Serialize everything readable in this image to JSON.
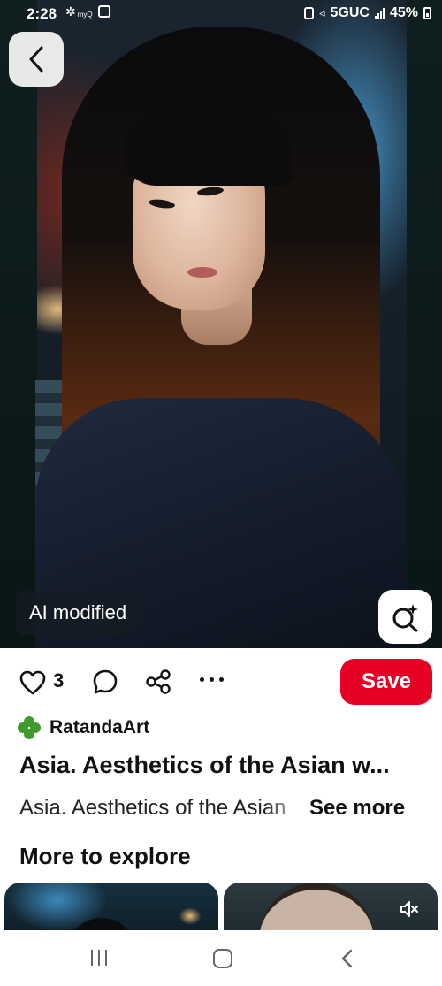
{
  "status_bar": {
    "time": "2:28",
    "myq": "myQ",
    "network": "5GUC",
    "battery": "45%"
  },
  "image": {
    "ai_badge": "AI modified"
  },
  "actions": {
    "like_count": "3",
    "save_label": "Save"
  },
  "creator": {
    "name": "RatandaArt"
  },
  "pin": {
    "title": "Asia. Aesthetics of the Asian w...",
    "description": "Asia. Aesthetics of the Asian",
    "see_more": "See more"
  },
  "explore": {
    "title": "More to explore"
  },
  "icons": {
    "back": "chevron-left-icon",
    "lens": "visual-search-icon",
    "like": "heart-icon",
    "comment": "comment-icon",
    "share": "share-icon",
    "more": "more-icon",
    "creator": "clover-icon",
    "mute": "mute-icon"
  },
  "colors": {
    "save": "#e60023",
    "creator_icon": "#3f9b2e"
  }
}
